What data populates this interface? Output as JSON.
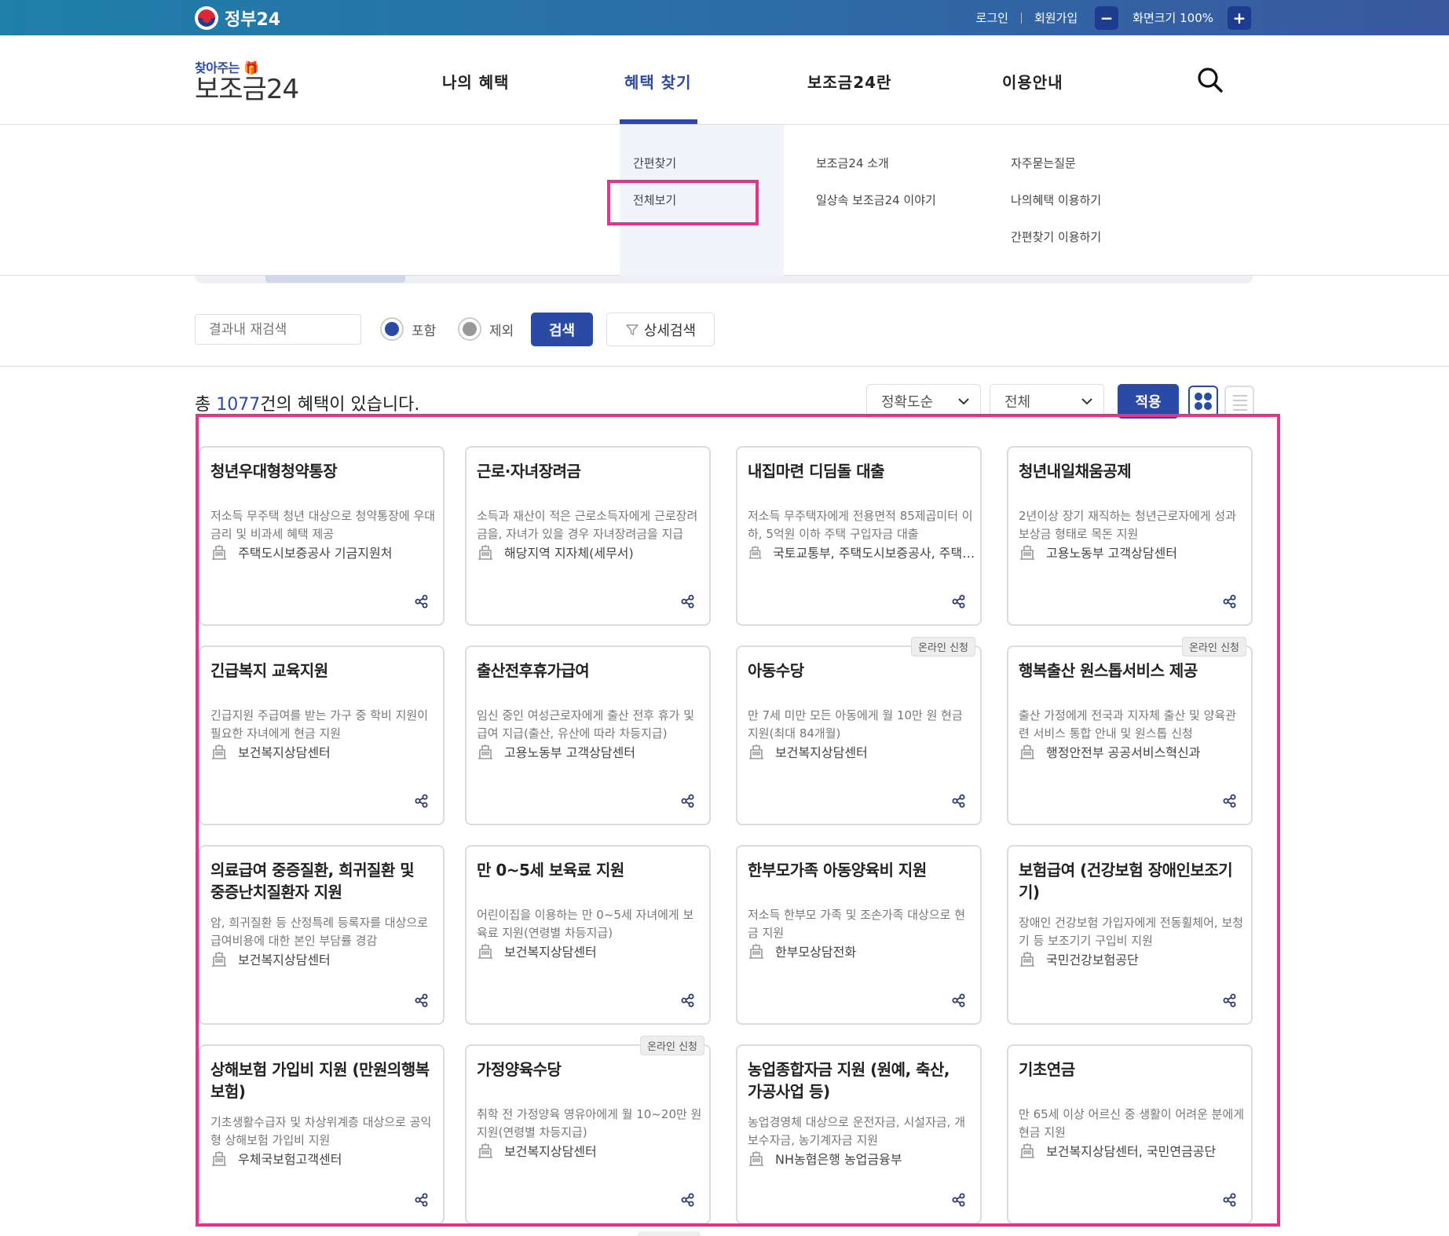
{
  "govbar": {
    "name": "정부24",
    "login": "로그인",
    "signup": "회원가입",
    "zoom_out": "−",
    "zoom_label": "화면크기 100%",
    "zoom_in": "+"
  },
  "header": {
    "brand_top": "찾아주는",
    "brand_main": "보조금24",
    "nav": [
      "나의 혜택",
      "혜택 찾기",
      "보조금24란",
      "이용안내"
    ]
  },
  "dropdown": {
    "col1": [
      "간편찾기",
      "전체보기"
    ],
    "col2": [
      "보조금24 소개",
      "일상속 보조금24 이야기"
    ],
    "col3": [
      "자주묻는질문",
      "나의혜택 이용하기",
      "간편찾기 이용하기"
    ]
  },
  "search": {
    "placeholder": "결과내 재검색",
    "include": "포함",
    "exclude": "제외",
    "search_btn": "검색",
    "detail_btn": "상세검색"
  },
  "results": {
    "prefix": "총 ",
    "count": "1077",
    "suffix": "건의 혜택이 있습니다.",
    "sort_selected": "정확도순",
    "filter_selected": "전체",
    "apply_btn": "적용"
  },
  "colors": {
    "brand": "#2b4aa6",
    "highlight": "#e3338a"
  },
  "cards": [
    {
      "title": "청년우대형청약통장",
      "desc": "저소득 무주택 청년 대상으로 청약통장에 우대금리 및 비과세 혜택 제공",
      "org": "주택도시보증공사 기금지원처",
      "badge": ""
    },
    {
      "title": "근로·자녀장려금",
      "desc": "소득과 재산이 적은 근로소득자에게 근로장려금을, 자녀가 있을 경우 자녀장려금을 지급",
      "org": "해당지역 지자체(세무서)",
      "badge": ""
    },
    {
      "title": "내집마련 디딤돌 대출",
      "desc": "저소득 무주택자에게 전용면적 85제곱미터 이하, 5억원 이하 주택 구입자금 대출",
      "org": "국토교통부, 주택도시보증공사, 주택도시기금",
      "badge": ""
    },
    {
      "title": "청년내일채움공제",
      "desc": "2년이상 장기 재직하는 청년근로자에게 성과보상금 형태로 목돈 지원",
      "org": "고용노동부 고객상담센터",
      "badge": ""
    },
    {
      "title": "긴급복지 교육지원",
      "desc": "긴급지원 주급여를 받는 가구 중 학비 지원이 필요한 자녀에게 현금 지원",
      "org": "보건복지상담센터",
      "badge": ""
    },
    {
      "title": "출산전후휴가급여",
      "desc": "임신 중인 여성근로자에게 출산 전후 휴가 및 급여 지급(출산, 유산에 따라 차등지급)",
      "org": "고용노동부 고객상담센터",
      "badge": ""
    },
    {
      "title": "아동수당",
      "desc": "만 7세 미만 모든 아동에게 월 10만 원 현금 지원(최대 84개월)",
      "org": "보건복지상담센터",
      "badge": "온라인 신청"
    },
    {
      "title": "행복출산 원스톱서비스 제공",
      "desc": "출산 가정에게 전국과 지자체 출산 및 양육관련 서비스 통합 안내 및 원스톱 신청",
      "org": "행정안전부 공공서비스혁신과",
      "badge": "온라인 신청"
    },
    {
      "title": "의료급여 중증질환, 희귀질환 및 중증난치질환자 지원",
      "desc": "암, 희귀질환 등 산정특례 등록자를 대상으로 급여비용에 대한 본인 부담률 경감",
      "org": "보건복지상담센터",
      "badge": ""
    },
    {
      "title": "만 0~5세 보육료 지원",
      "desc": "어린이집을 이용하는 만 0~5세 자녀에게 보육료 지원(연령별 차등지급)",
      "org": "보건복지상담센터",
      "badge": ""
    },
    {
      "title": "한부모가족 아동양육비 지원",
      "desc": "저소득 한부모 가족 및 조손가족 대상으로 현금 지원",
      "org": "한부모상담전화",
      "badge": ""
    },
    {
      "title": "보험급여 (건강보험 장애인보조기기)",
      "desc": "장애인 건강보험 가입자에게 전동휠체어, 보청기 등 보조기기 구입비 지원",
      "org": "국민건강보험공단",
      "badge": ""
    },
    {
      "title": "상해보험 가입비 지원 (만원의행복보험)",
      "desc": "기초생활수급자 및 차상위계층 대상으로 공익형 상해보험 가입비 지원",
      "org": "우체국보험고객센터",
      "badge": ""
    },
    {
      "title": "가정양육수당",
      "desc": "취학 전 가정양육 영유아에게 월 10~20만 원 지원(연령별 차등지급)",
      "org": "보건복지상담센터",
      "badge": "온라인 신청"
    },
    {
      "title": "농업종합자금 지원 (원예, 축산, 가공사업 등)",
      "desc": "농업경영체 대상으로 운전자금, 시설자금, 개보수자금, 농기계자금 지원",
      "org": "NH농협은행 농업금융부",
      "badge": ""
    },
    {
      "title": "기초연금",
      "desc": "만 65세 이상 어르신 중 생활이 어려운 분에게 현금 지원",
      "org": "보건복지상담센터, 국민연금공단",
      "badge": ""
    }
  ]
}
